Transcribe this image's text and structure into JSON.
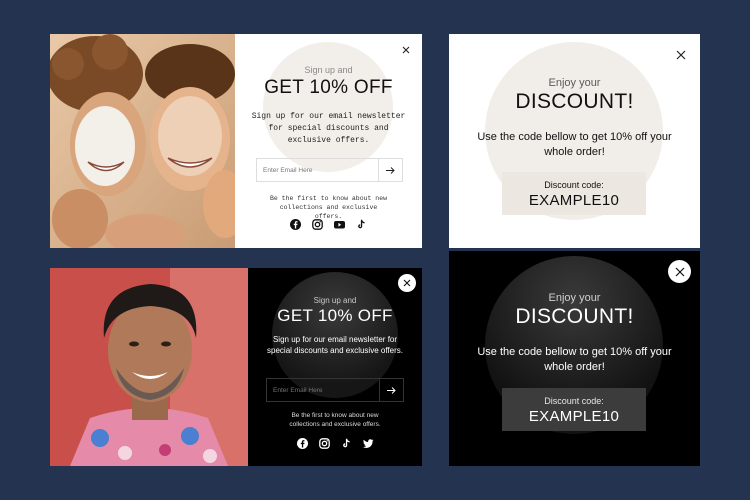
{
  "background_color": "#233350",
  "cards": [
    {
      "id": "card-light-newsletter",
      "theme": "light",
      "kicker": "Sign up and",
      "headline": "GET 10% OFF",
      "description": "Sign up for our email newsletter for special discounts and exclusive offers.",
      "email_placeholder": "Enter Email Here",
      "note": "Be the first to know about new collections and exclusive offers.",
      "socials": [
        "facebook-icon",
        "instagram-icon",
        "youtube-icon",
        "tiktok-icon"
      ]
    },
    {
      "id": "card-dark-newsletter",
      "theme": "dark",
      "kicker": "Sign up and",
      "headline": "GET 10% OFF",
      "description": "Sign up for our email newsletter for special discounts and exclusive offers.",
      "email_placeholder": "Enter Email Here",
      "note": "Be the first to know about new collections and exclusive offers.",
      "socials": [
        "facebook-icon",
        "instagram-icon",
        "tiktok-icon",
        "twitter-icon"
      ]
    },
    {
      "id": "card-light-discount",
      "theme": "light",
      "kicker": "Enjoy your",
      "headline": "DISCOUNT!",
      "description": "Use the code bellow to get 10% off your whole order!",
      "code_label": "Discount code:",
      "code_value": "EXAMPLE10"
    },
    {
      "id": "card-dark-discount",
      "theme": "dark",
      "kicker": "Enjoy your",
      "headline": "DISCOUNT!",
      "description": "Use the code bellow to get 10% off your whole order!",
      "code_label": "Discount code:",
      "code_value": "EXAMPLE10"
    }
  ],
  "colors": {
    "light_bg": "#ffffff",
    "light_arch": "#f1eee9",
    "light_code_box": "#ece7e1",
    "dark_bg": "#000000",
    "dark_arch": "#2a2a2a",
    "dark_code_box": "#3c3c3c"
  }
}
